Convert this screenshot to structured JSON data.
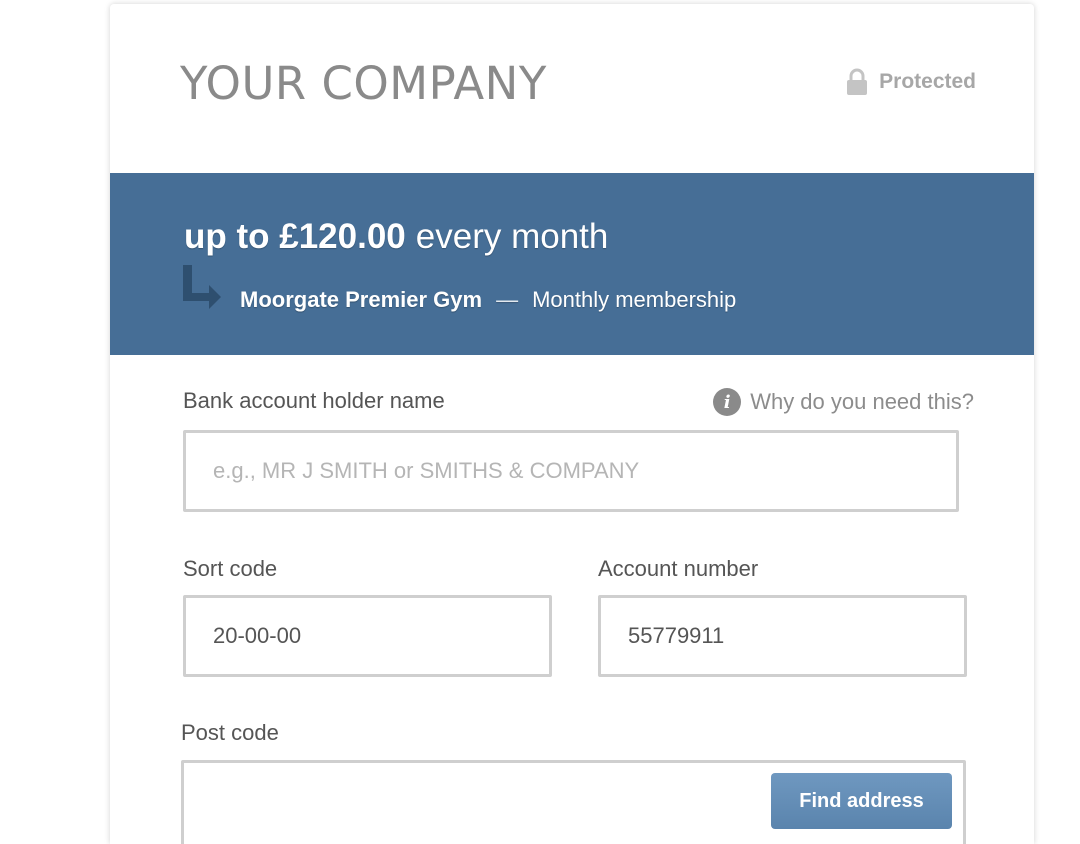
{
  "header": {
    "company_name": "YOUR COMPANY",
    "protected_label": "Protected"
  },
  "banner": {
    "amount": "up to £120.00",
    "period": "every month",
    "merchant": "Moorgate Premier Gym",
    "separator": "—",
    "description": "Monthly membership"
  },
  "form": {
    "holder_name": {
      "label": "Bank account holder name",
      "help_link": "Why do you need this?",
      "value": "",
      "placeholder": "e.g., MR J SMITH or SMITHS & COMPANY"
    },
    "sort_code": {
      "label": "Sort code",
      "value": "20-00-00"
    },
    "account_number": {
      "label": "Account number",
      "value": "55779911"
    },
    "post_code": {
      "label": "Post code",
      "value": "",
      "button_label": "Find address"
    }
  },
  "colors": {
    "banner_bg": "#466e96",
    "button_bg": "#6690b8",
    "company_text": "#8a8a8a"
  },
  "icons": [
    "lock-icon",
    "arrow-return-icon",
    "info-icon"
  ]
}
